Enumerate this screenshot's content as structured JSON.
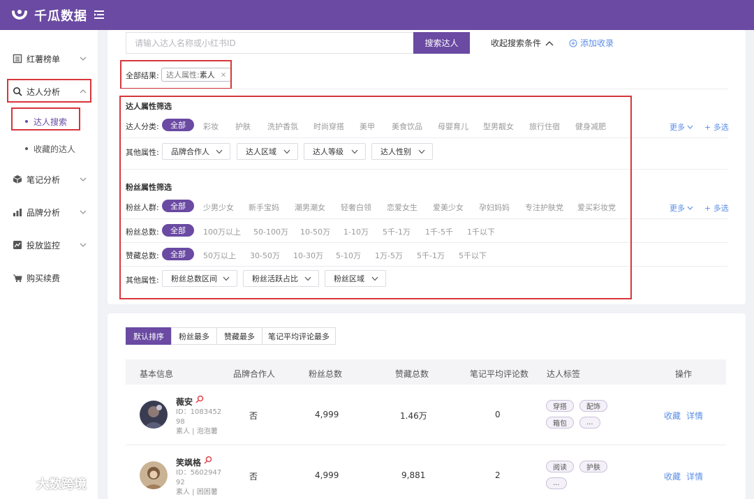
{
  "app": {
    "title": "千瓜数据"
  },
  "sidebar": {
    "items": [
      {
        "label": "红薯榜单",
        "icon": "list-icon"
      },
      {
        "label": "达人分析",
        "icon": "search-icon",
        "active": true
      },
      {
        "label": "笔记分析",
        "icon": "cube-icon"
      },
      {
        "label": "品牌分析",
        "icon": "bar-chart-icon"
      },
      {
        "label": "投放监控",
        "icon": "monitor-chart-icon"
      },
      {
        "label": "购买续费",
        "icon": "cart-icon"
      }
    ],
    "sub_items": [
      {
        "label": "达人搜索",
        "active": true
      },
      {
        "label": "收藏的达人"
      }
    ]
  },
  "search": {
    "placeholder": "请输入达人名称或小红书ID",
    "button_label": "搜索达人",
    "collapse_label": "收起搜索条件",
    "add_label": "添加收录"
  },
  "results": {
    "label": "全部结果:",
    "chip_key": "达人属性:",
    "chip_value": "素人",
    "chip_close": "×"
  },
  "filters": {
    "influencer_title": "达人属性筛选",
    "category_label": "达人分类:",
    "categories": [
      "全部",
      "彩妆",
      "护肤",
      "洗护香氛",
      "时尚穿搭",
      "美甲",
      "美食饮品",
      "母婴育儿",
      "型男靓女",
      "旅行住宿",
      "健身减肥"
    ],
    "more_label": "更多",
    "multi_label": "+ 多选",
    "other_label": "其他属性:",
    "other_dropdowns": [
      "品牌合作人",
      "达人区域",
      "达人等级",
      "达人性别"
    ],
    "fans_title": "粉丝属性筛选",
    "crowd_label": "粉丝人群:",
    "crowds": [
      "全部",
      "少男少女",
      "新手宝妈",
      "潮男潮女",
      "轻奢白领",
      "恋爱女生",
      "爱美少女",
      "孕妇妈妈",
      "专注护肤党",
      "爱买彩妆党"
    ],
    "fans_total_label": "粉丝总数:",
    "fans_totals": [
      "全部",
      "100万以上",
      "50-100万",
      "10-50万",
      "1-10万",
      "5千-1万",
      "1千-5千",
      "1千以下"
    ],
    "likes_label": "赞藏总数:",
    "likes": [
      "全部",
      "50万以上",
      "30-50万",
      "10-30万",
      "5-10万",
      "1万-5万",
      "5千-1万",
      "5千以下"
    ],
    "fans_other_label": "其他属性:",
    "fans_other_dropdowns": [
      "粉丝总数区间",
      "粉丝活跃占比",
      "粉丝区域"
    ]
  },
  "sort_tabs": [
    "默认排序",
    "粉丝最多",
    "赞藏最多",
    "笔记平均评论最多"
  ],
  "table": {
    "headers": [
      "基本信息",
      "品牌合作人",
      "粉丝总数",
      "赞藏总数",
      "笔记平均评论数",
      "达人标签",
      "操作"
    ],
    "rows": [
      {
        "name": "薇安",
        "id_line1": "ID：1083452",
        "id_line2": "98",
        "meta": "素人 | 泡泡薯",
        "brand_partner": "否",
        "fans": "4,999",
        "likes": "1.46万",
        "avg_comments": "0",
        "tags": [
          "穿搭",
          "配饰",
          "箱包",
          "..."
        ],
        "actions": [
          "收藏",
          "详情"
        ]
      },
      {
        "name": "笑飒格",
        "id_line1": "ID：5602947",
        "id_line2": "92",
        "meta": "素人 | 困困薯",
        "brand_partner": "否",
        "fans": "4,999",
        "likes": "9,881",
        "avg_comments": "2",
        "tags": [
          "阅读",
          "护肤",
          "..."
        ],
        "actions": [
          "收藏",
          "详情"
        ]
      }
    ]
  },
  "watermark": {
    "text": "大数跨境"
  },
  "colors": {
    "brand": "#6a4aa2",
    "link": "#5b8ee6",
    "highlight_box": "#d7363b"
  }
}
